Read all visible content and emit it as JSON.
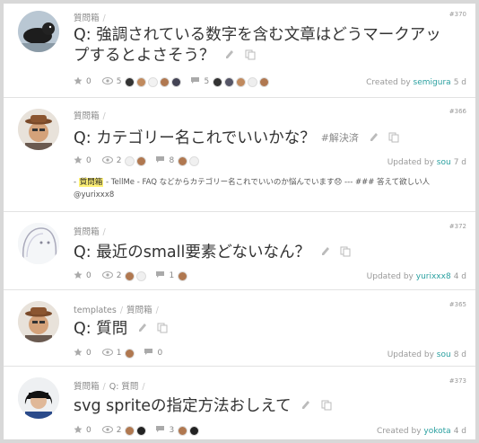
{
  "posts": [
    {
      "id": "#370",
      "crumbs": [
        "質問箱"
      ],
      "title": "Q: 強調されている数字を含む文章はどうマークアップするとよさそう？",
      "tag": "",
      "stars": "0",
      "views": "5",
      "comments": "5",
      "status_prefix": "Created by",
      "user": "semigura",
      "time": "5 d",
      "avatar": "black-dog"
    },
    {
      "id": "#366",
      "crumbs": [
        "質問箱"
      ],
      "title": "Q: カテゴリー名これでいいかな？",
      "tag": "#解決済",
      "stars": "0",
      "views": "2",
      "comments": "8",
      "status_prefix": "Updated by",
      "user": "sou",
      "time": "7 d",
      "avatar": "man-with-hat",
      "excerpt": {
        "prefix": "- ",
        "highlight": "質問箱",
        "body": " - TellMe - FAQ などからカテゴリー名これでいいのか悩んでいます😞 --- ### 答えて欲しい人 @yurixxx8"
      }
    },
    {
      "id": "#372",
      "crumbs": [
        "質問箱"
      ],
      "title": "Q: 最近のsmall要素どないなん？",
      "tag": "",
      "stars": "0",
      "views": "2",
      "comments": "1",
      "status_prefix": "Updated by",
      "user": "yurixxx8",
      "time": "4 d",
      "avatar": "sketch-girl"
    },
    {
      "id": "#365",
      "crumbs": [
        "templates",
        "質問箱"
      ],
      "title": "Q: 質問",
      "tag": "",
      "stars": "0",
      "views": "1",
      "comments": "0",
      "status_prefix": "Updated by",
      "user": "sou",
      "time": "8 d",
      "avatar": "man-with-hat"
    },
    {
      "id": "#373",
      "crumbs": [
        "質問箱",
        "Q: 質問"
      ],
      "title": "svg spriteの指定方法おしえて",
      "tag": "",
      "stars": "0",
      "views": "2",
      "comments": "3",
      "status_prefix": "Created by",
      "user": "yokota",
      "time": "4 d",
      "avatar": "woman-black-hair"
    }
  ],
  "icons": {
    "star": "star-icon",
    "eye": "eye-icon",
    "comment": "comment-icon",
    "edit": "pencil-icon",
    "copy": "copy-icon"
  },
  "colors": {
    "user_link": "#2aa0a0",
    "highlight": "#fff176"
  }
}
